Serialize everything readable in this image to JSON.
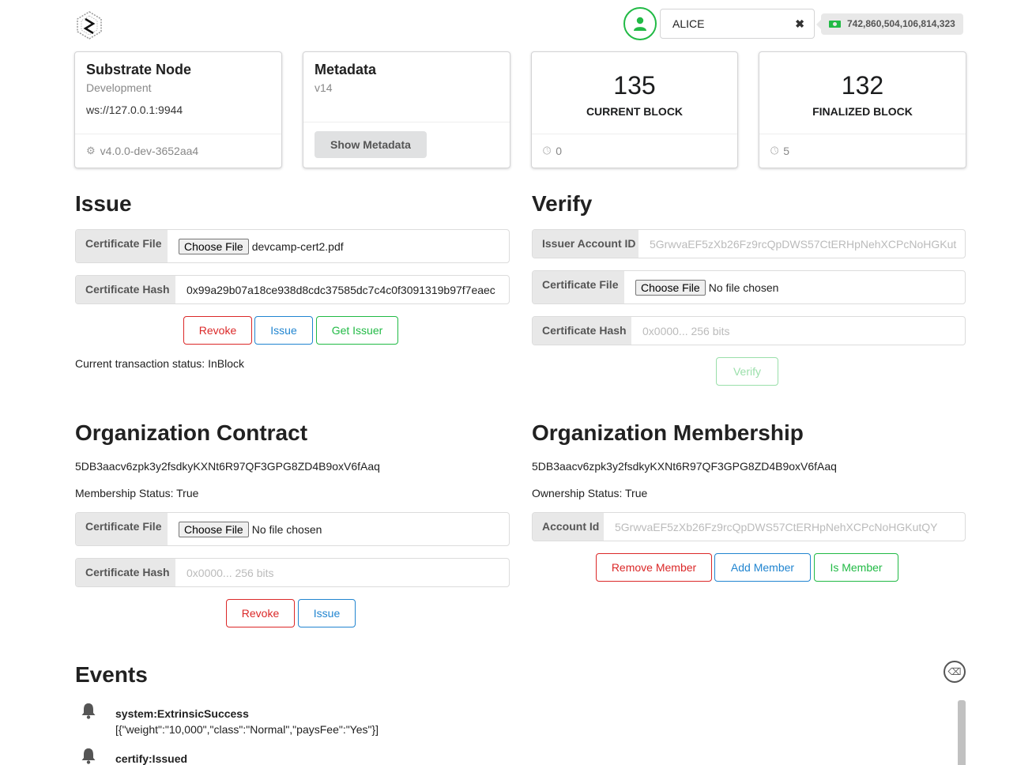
{
  "header": {
    "account_name": "ALICE",
    "balance": "742,860,504,106,814,323",
    "clear_symbol": "✖"
  },
  "cards": {
    "node": {
      "title": "Substrate Node",
      "chain": "Development",
      "endpoint": "ws://127.0.0.1:9944",
      "version": "v4.0.0-dev-3652aa4"
    },
    "metadata": {
      "title": "Metadata",
      "version": "v14",
      "button": "Show Metadata"
    },
    "current_block": {
      "value": "135",
      "label": "CURRENT BLOCK",
      "timer": "0"
    },
    "finalized_block": {
      "value": "132",
      "label": "FINALIZED BLOCK",
      "timer": "5"
    }
  },
  "issue": {
    "title": "Issue",
    "file_label": "Certificate File",
    "choose_file": "Choose File",
    "file_name": "devcamp-cert2.pdf",
    "hash_label": "Certificate Hash",
    "hash_value": "0x99a29b07a18ce938d8cdc37585dc7c4c0f3091319b97f7eaec",
    "buttons": {
      "revoke": "Revoke",
      "issue": "Issue",
      "get_issuer": "Get Issuer"
    },
    "status": "Current transaction status: InBlock"
  },
  "verify": {
    "title": "Verify",
    "issuer_label": "Issuer Account ID",
    "issuer_placeholder": "5GrwvaEF5zXb26Fz9rcQpDWS57CtERHpNehXCPcNoHGKut",
    "file_label": "Certificate File",
    "choose_file": "Choose File",
    "file_name": "No file chosen",
    "hash_label": "Certificate Hash",
    "hash_placeholder": "0x0000... 256 bits",
    "button": "Verify"
  },
  "org_contract": {
    "title": "Organization Contract",
    "address": "5DB3aacv6zpk3y2fsdkyKXNt6R97QF3GPG8ZD4B9oxV6fAaq",
    "status": "Membership Status: True",
    "file_label": "Certificate File",
    "choose_file": "Choose File",
    "file_name": "No file chosen",
    "hash_label": "Certificate Hash",
    "hash_placeholder": "0x0000... 256 bits",
    "buttons": {
      "revoke": "Revoke",
      "issue": "Issue"
    }
  },
  "org_membership": {
    "title": "Organization Membership",
    "address": "5DB3aacv6zpk3y2fsdkyKXNt6R97QF3GPG8ZD4B9oxV6fAaq",
    "status": "Ownership Status: True",
    "account_label": "Account Id",
    "account_placeholder": "5GrwvaEF5zXb26Fz9rcQpDWS57CtERHpNehXCPcNoHGKutQY",
    "buttons": {
      "remove": "Remove Member",
      "add": "Add Member",
      "is_member": "Is Member"
    }
  },
  "events": {
    "title": "Events",
    "items": [
      {
        "name": "system:ExtrinsicSuccess",
        "detail": "[{\"weight\":\"10,000\",\"class\":\"Normal\",\"paysFee\":\"Yes\"}]"
      },
      {
        "name": "certify:Issued",
        "detail": ""
      }
    ]
  },
  "colors": {
    "red": "#db2828",
    "blue": "#2185d0",
    "green": "#21ba45"
  }
}
